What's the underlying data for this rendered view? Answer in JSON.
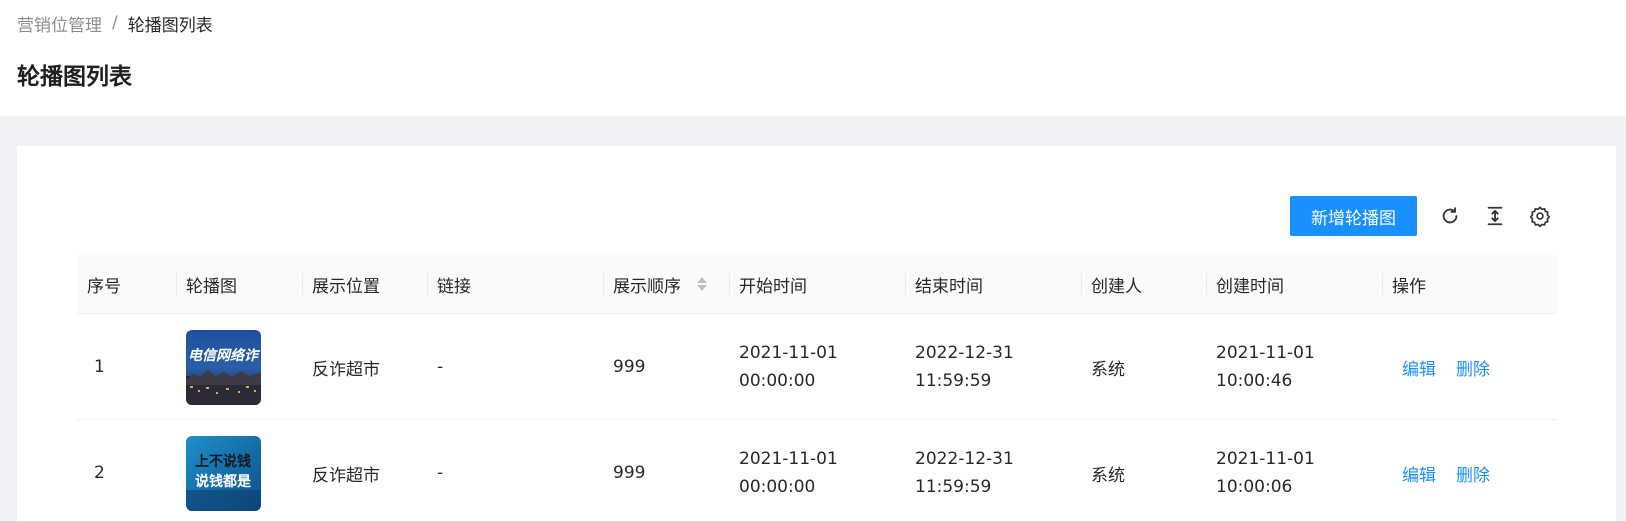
{
  "breadcrumb": {
    "parent": "营销位管理",
    "separator": "/",
    "current": "轮播图列表"
  },
  "page_title": "轮播图列表",
  "toolbar": {
    "add_label": "新增轮播图",
    "icons": [
      "reload-icon",
      "column-height-icon",
      "setting-icon"
    ]
  },
  "table": {
    "columns": [
      "序号",
      "轮播图",
      "展示位置",
      "链接",
      "展示顺序",
      "开始时间",
      "结束时间",
      "创建人",
      "创建时间",
      "操作"
    ],
    "rows": [
      {
        "index": "1",
        "image_text": "电信网络诈",
        "position": "反诈超市",
        "link": "-",
        "order": "999",
        "start_date": "2021-11-01",
        "start_time": "00:00:00",
        "end_date": "2022-12-31",
        "end_time": "11:59:59",
        "creator": "系统",
        "created_date": "2021-11-01",
        "created_time": "10:00:46",
        "edit": "编辑",
        "delete": "删除"
      },
      {
        "index": "2",
        "image_text_line1": "上不说钱",
        "image_text_line2": "说钱都是",
        "position": "反诈超市",
        "link": "-",
        "order": "999",
        "start_date": "2021-11-01",
        "start_time": "00:00:00",
        "end_date": "2022-12-31",
        "end_time": "11:59:59",
        "creator": "系统",
        "created_date": "2021-11-01",
        "created_time": "10:00:06",
        "edit": "编辑",
        "delete": "删除"
      }
    ]
  },
  "colors": {
    "primary": "#1890ff",
    "background": "#f0f2f5",
    "header_bg": "#fafafa"
  }
}
